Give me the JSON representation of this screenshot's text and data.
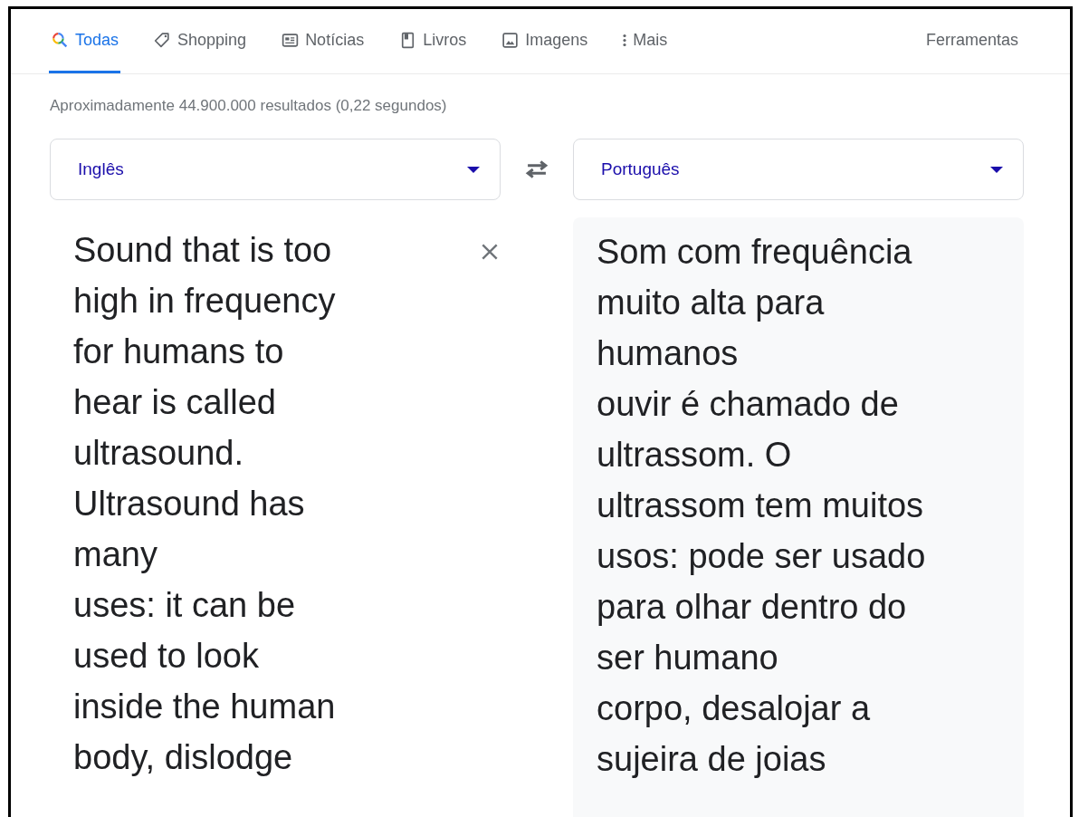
{
  "tabs": [
    {
      "label": "Todas",
      "kind": "all",
      "selected": true
    },
    {
      "label": "Shopping",
      "kind": "shopping",
      "selected": false
    },
    {
      "label": "Notícias",
      "kind": "news",
      "selected": false
    },
    {
      "label": "Livros",
      "kind": "books",
      "selected": false
    },
    {
      "label": "Imagens",
      "kind": "images",
      "selected": false
    },
    {
      "label": "Mais",
      "kind": "more",
      "selected": false
    }
  ],
  "tools": "Ferramentas",
  "result_stats": "Aproximadamente 44.900.000 resultados (0,22 segundos)",
  "translator": {
    "source_language": "Inglês",
    "target_language": "Português",
    "source_text": "Sound that is too\nhigh in frequency\nfor humans to\nhear is called\nultrasound.\nUltrasound has\nmany\nuses: it can be\nused to look\ninside the human\nbody, dislodge",
    "translation": "Som com frequência\nmuito alta para\nhumanos\nouvir é chamado de\nultrassom. O\nultrassom tem muitos\nusos: pode ser usado\npara olhar dentro do\nser humano\ncorpo, desalojar a\nsujeira de joias"
  }
}
